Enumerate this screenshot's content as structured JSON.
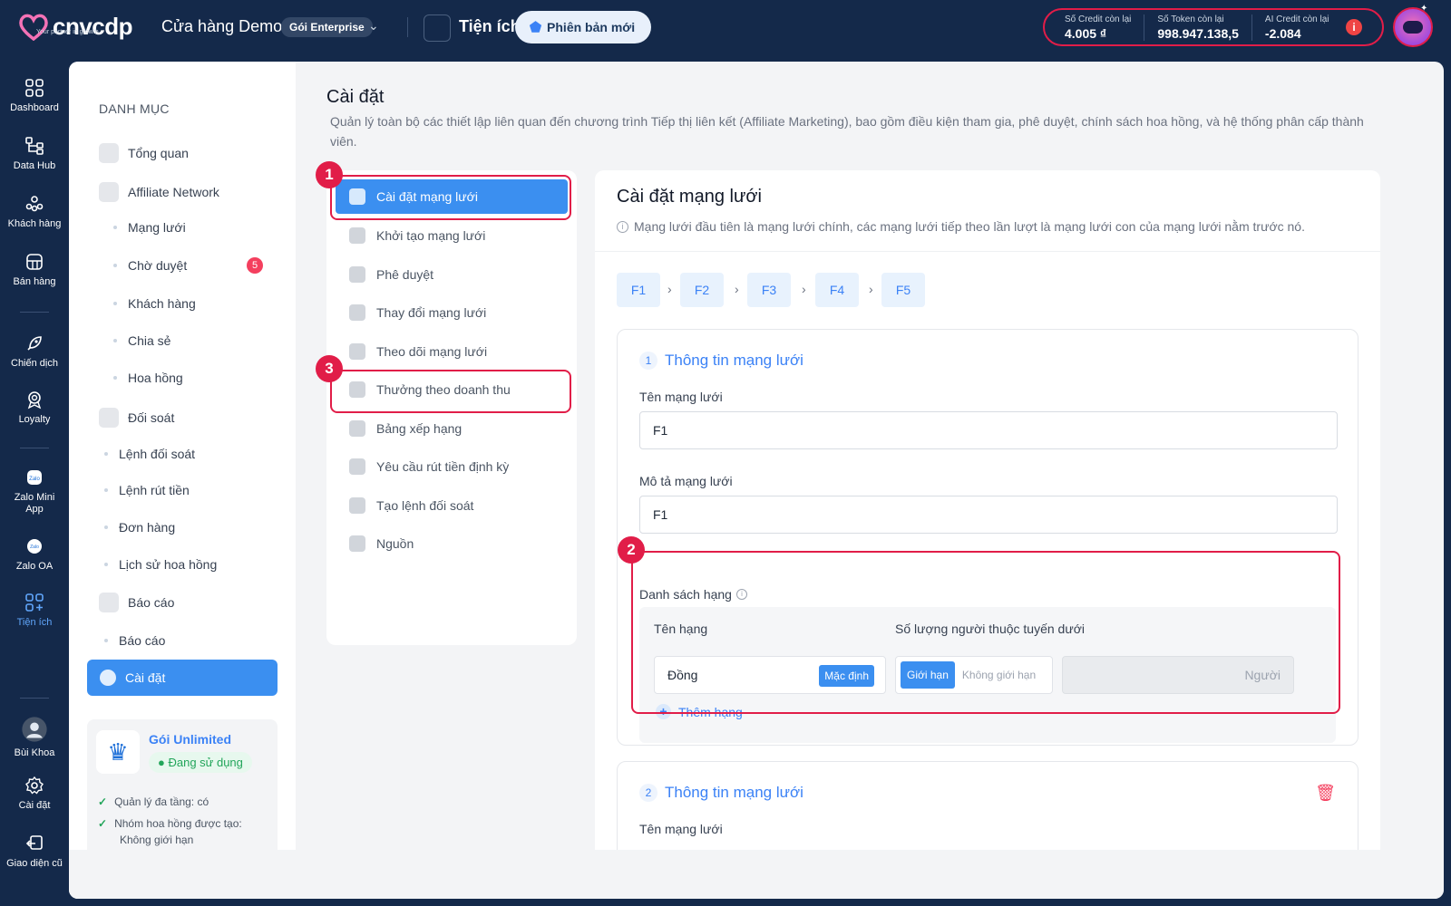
{
  "topbar": {
    "logo": "cnvcdp",
    "logo_tagline": "Your partner in growth",
    "store_name": "Cửa hàng Demo",
    "plan_badge": "Gói Enterprise",
    "tools_label": "Tiện ích",
    "new_version": "Phiên bản mới",
    "credits": [
      {
        "label": "Số Credit còn lại",
        "value": "4.005 ₫"
      },
      {
        "label": "Số Token còn lại",
        "value": "998.947.138,5"
      },
      {
        "label": "AI Credit còn lại",
        "value": "-2.084"
      }
    ]
  },
  "rail": [
    {
      "label": "Dashboard",
      "icon": "dashboard-icon"
    },
    {
      "label": "Data Hub",
      "icon": "data-hub-icon"
    },
    {
      "label": "Khách hàng",
      "icon": "customers-icon"
    },
    {
      "label": "Bán hàng",
      "icon": "sales-icon"
    },
    {
      "label": "Chiến dịch",
      "icon": "rocket-icon"
    },
    {
      "label": "Loyalty",
      "icon": "loyalty-icon"
    },
    {
      "label": "Zalo Mini App",
      "icon": "zalo-mini-app-icon"
    },
    {
      "label": "Zalo OA",
      "icon": "zalo-oa-icon"
    },
    {
      "label": "Tiện ích",
      "icon": "utilities-icon"
    },
    {
      "label": "Bùi Khoa",
      "icon": "user-avatar-icon"
    },
    {
      "label": "Cài đặt",
      "icon": "gear-icon"
    },
    {
      "label": "Giao diện cũ",
      "icon": "old-ui-icon"
    }
  ],
  "category": {
    "title": "DANH MỤC",
    "items": [
      {
        "label": "Tổng quan"
      },
      {
        "label": "Affiliate Network"
      },
      {
        "label": "Mạng lưới"
      },
      {
        "label": "Chờ duyệt",
        "badge": "5"
      },
      {
        "label": "Khách hàng"
      },
      {
        "label": "Chia sẻ"
      },
      {
        "label": "Hoa hồng"
      },
      {
        "label": "Đối soát"
      },
      {
        "label": "Lệnh đối soát"
      },
      {
        "label": "Lệnh rút tiền"
      },
      {
        "label": "Đơn hàng"
      },
      {
        "label": "Lịch sử hoa hồng"
      },
      {
        "label": "Báo cáo"
      },
      {
        "label": "Báo cáo"
      },
      {
        "label": "Cài đặt"
      }
    ],
    "plan": {
      "name": "Gói Unlimited",
      "status": "Đang sử dụng",
      "features": [
        "Quản lý đa tầng: có",
        "Nhóm hoa hồng được tạo: Không giới hạn"
      ]
    }
  },
  "page": {
    "title": "Cài đặt",
    "description": "Quản lý toàn bộ các thiết lập liên quan đến chương trình Tiếp thị liên kết (Affiliate Marketing), bao gồm điều kiện tham gia, phê duyệt, chính sách hoa hồng, và hệ thống phân cấp thành viên."
  },
  "settings_menu": [
    {
      "label": "Cài đặt mạng lưới"
    },
    {
      "label": "Khởi tạo mạng lưới"
    },
    {
      "label": "Phê duyệt"
    },
    {
      "label": "Thay đổi mạng lưới"
    },
    {
      "label": "Theo dõi mạng lưới"
    },
    {
      "label": "Thưởng theo doanh thu"
    },
    {
      "label": "Bảng xếp hạng"
    },
    {
      "label": "Yêu cầu rút tiền định kỳ"
    },
    {
      "label": "Tạo lệnh đối soát"
    },
    {
      "label": "Nguồn"
    }
  ],
  "markers": [
    "1",
    "2",
    "3"
  ],
  "form": {
    "title": "Cài đặt mạng lưới",
    "note": "Mạng lưới đầu tiên là mạng lưới chính, các mạng lưới tiếp theo lần lượt là mạng lưới con của mạng lưới nằm trước nó.",
    "steps": [
      "F1",
      "F2",
      "F3",
      "F4",
      "F5"
    ],
    "sections": [
      {
        "num": "1",
        "title": "Thông tin mạng lưới",
        "name_label": "Tên mạng lưới",
        "name_value": "F1",
        "desc_label": "Mô tả mạng lưới",
        "desc_value": "F1",
        "rank_list_label": "Danh sách hạng",
        "col_rank_name": "Tên hạng",
        "col_count": "Số lượng người thuộc tuyến dưới",
        "rank_name": "Đồng",
        "default_tag": "Mặc định",
        "limit_on": "Giới hạn",
        "limit_off": "Không giới hạn",
        "people_unit": "Người",
        "add_rank": "Thêm hạng"
      },
      {
        "num": "2",
        "title": "Thông tin mạng lưới",
        "name_label": "Tên mạng lưới"
      }
    ]
  }
}
